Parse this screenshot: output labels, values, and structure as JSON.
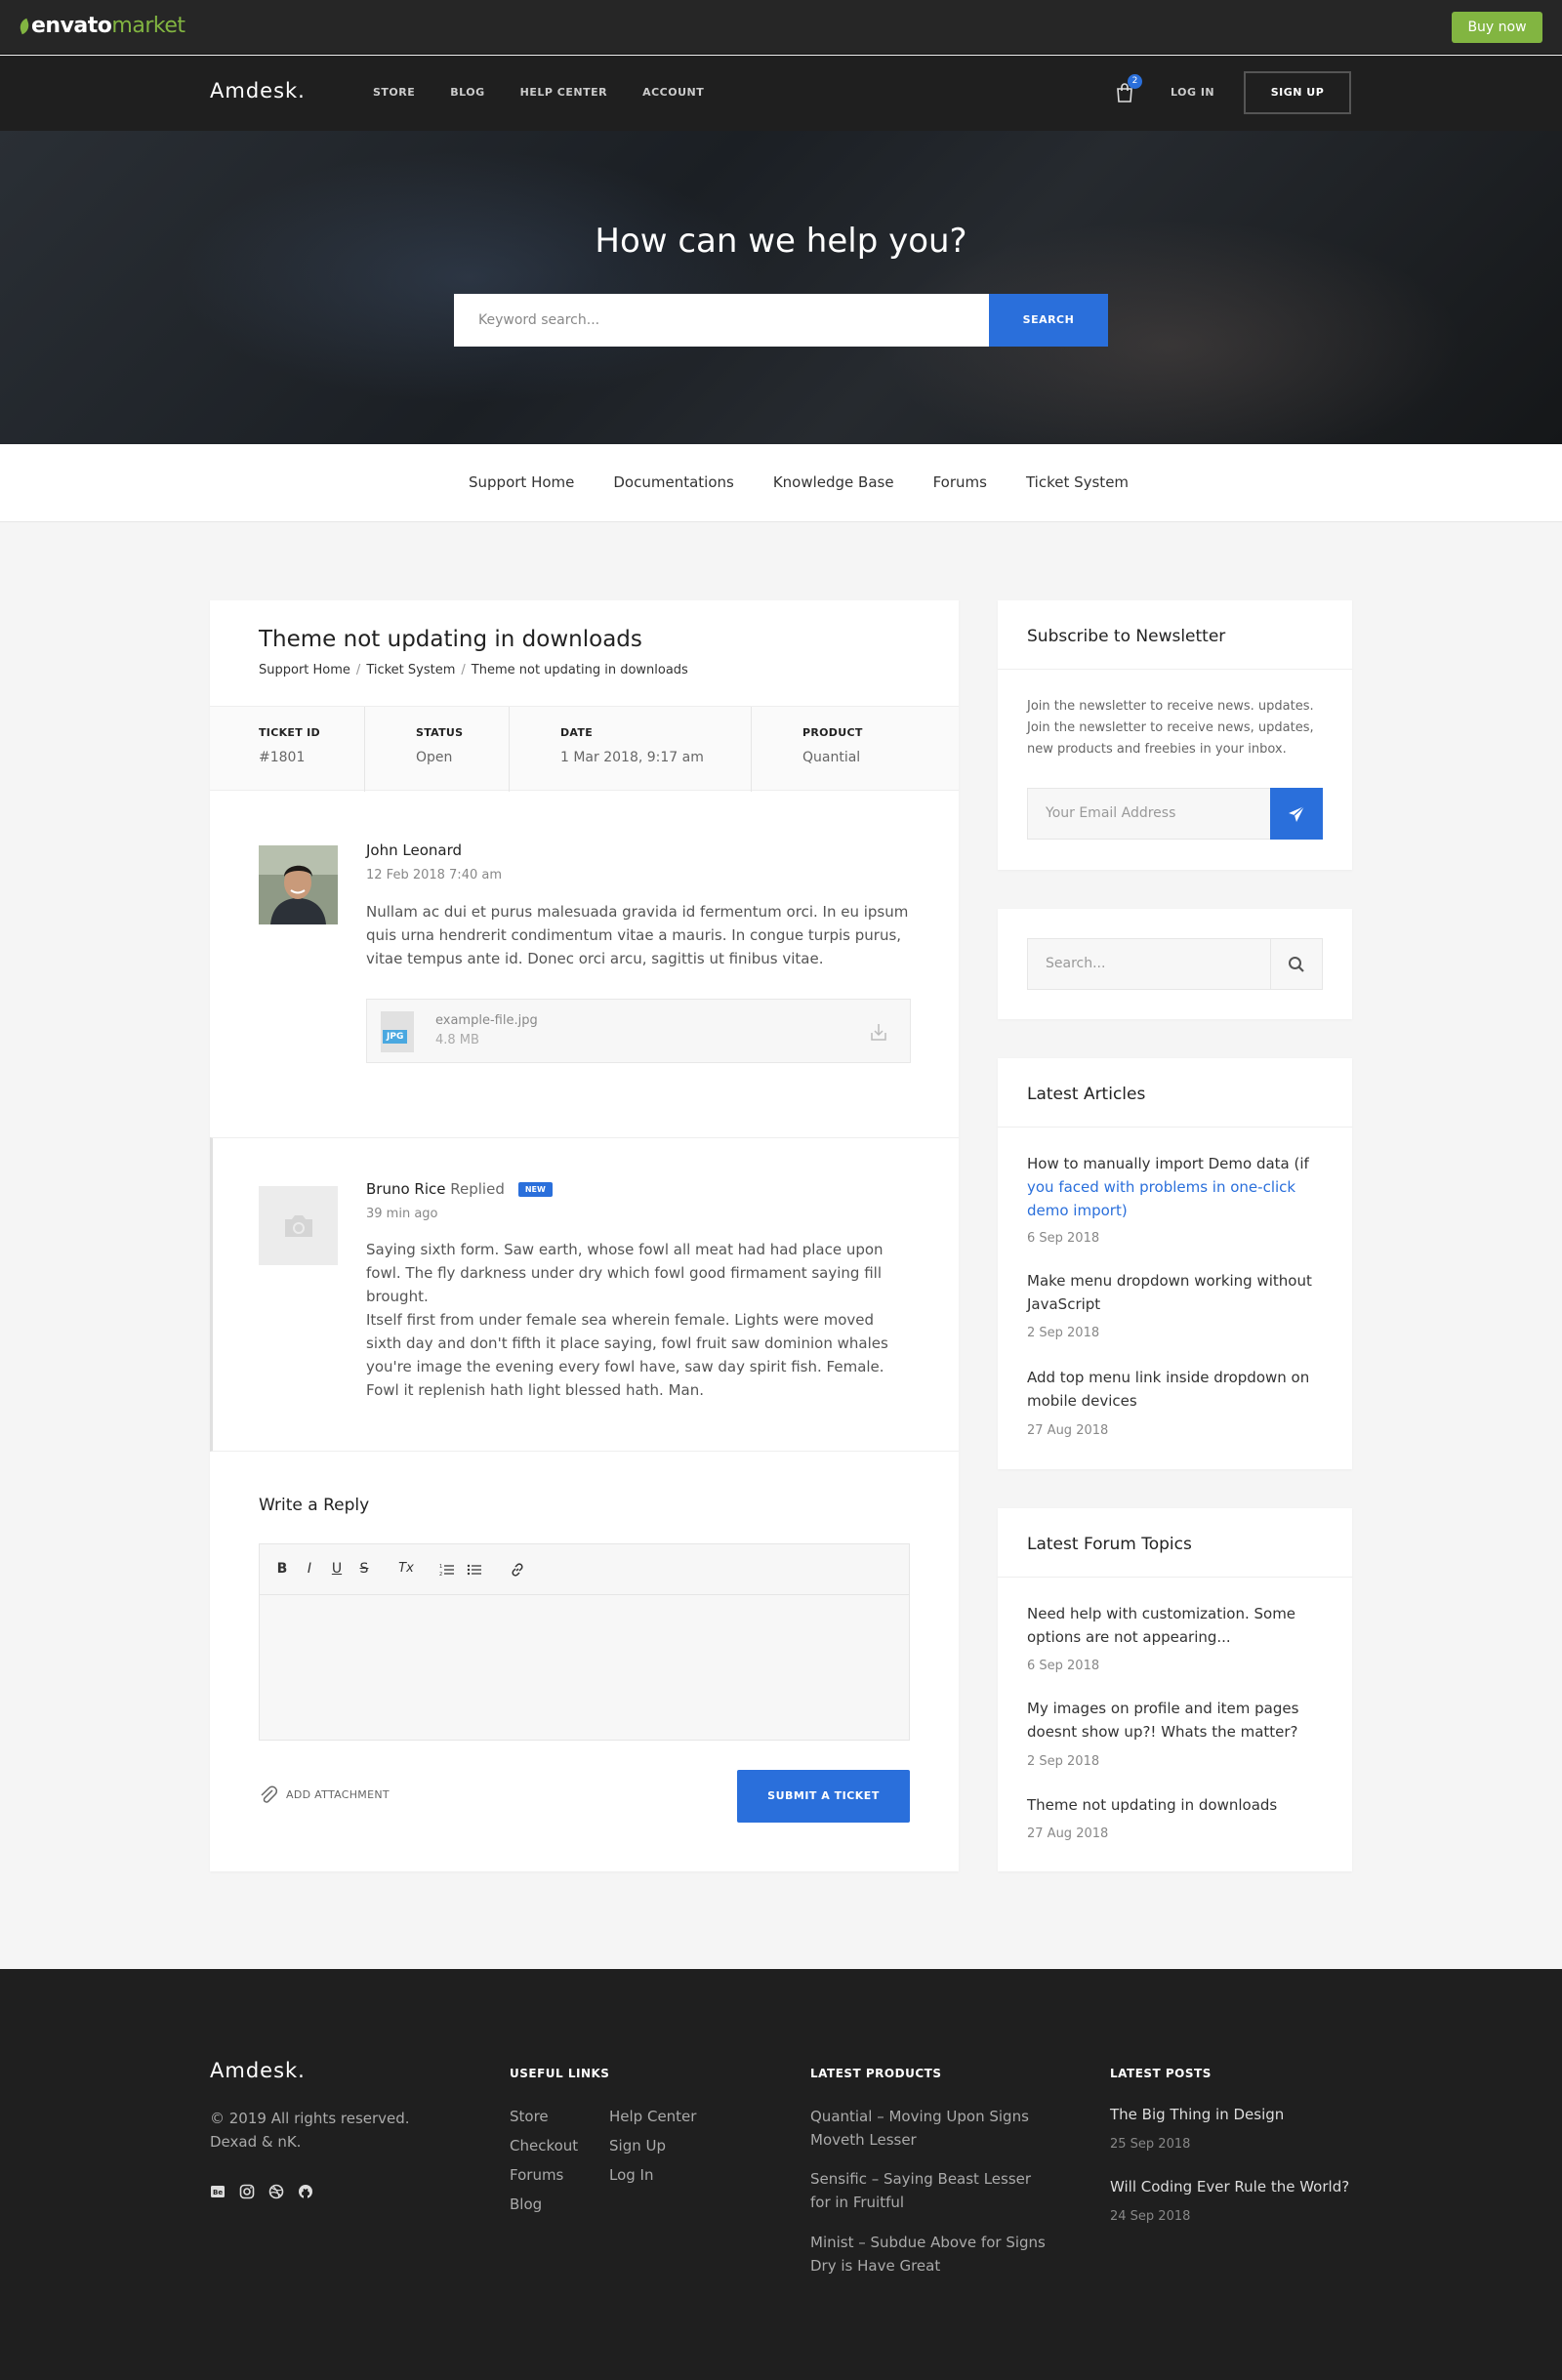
{
  "envato": {
    "logo_text": "envato",
    "logo_market": "market",
    "buy_now": "Buy now"
  },
  "header": {
    "brand": "Amdesk.",
    "nav": [
      "STORE",
      "BLOG",
      "HELP CENTER",
      "ACCOUNT"
    ],
    "cart_count": "2",
    "login": "LOG IN",
    "signup": "SIGN UP"
  },
  "hero": {
    "title": "How can we help you?",
    "search_placeholder": "Keyword search...",
    "search_button": "SEARCH"
  },
  "subnav": [
    "Support Home",
    "Documentations",
    "Knowledge Base",
    "Forums",
    "Ticket System"
  ],
  "ticket": {
    "title": "Theme not updating in downloads",
    "breadcrumb": [
      "Support Home",
      "Ticket System",
      "Theme not updating in downloads"
    ],
    "meta": [
      {
        "label": "TICKET ID",
        "value": "#1801"
      },
      {
        "label": "STATUS",
        "value": "Open"
      },
      {
        "label": "DATE",
        "value": "1 Mar 2018, 9:17 am"
      },
      {
        "label": "PRODUCT",
        "value": "Quantial"
      }
    ],
    "messages": [
      {
        "author": "John Leonard",
        "time": "12 Feb 2018 7:40 am",
        "body": "Nullam ac dui et purus malesuada gravida id fermentum orci. In eu ipsum quis urna hendrerit condimentum vitae a mauris. In congue turpis purus, vitae tempus ante id. Donec orci arcu, sagittis ut finibus vitae.",
        "attachment": {
          "type": "JPG",
          "name": "example-file.jpg",
          "size": "4.8 MB"
        }
      },
      {
        "author": "Bruno Rice",
        "replied": "Replied",
        "badge": "NEW",
        "time": "39 min ago",
        "body1": "Saying sixth form. Saw earth, whose fowl all meat had had place upon fowl. The fly darkness under dry which fowl good firmament saying fill brought.",
        "body2": "Itself first from under female sea wherein female. Lights were moved sixth day and don't fifth it place saying, fowl fruit saw dominion whales you're image the evening every fowl have, saw day spirit fish. Female. Fowl it replenish hath light blessed hath. Man."
      }
    ],
    "reply": {
      "title": "Write a Reply",
      "toolbar": [
        "B",
        "I",
        "U",
        "S",
        "Tx"
      ],
      "add_attachment": "ADD ATTACHMENT",
      "submit": "SUBMIT A TICKET"
    }
  },
  "sidebar": {
    "newsletter": {
      "title": "Subscribe to Newsletter",
      "text": "Join the newsletter to receive news. updates. Join the newsletter to receive news, updates, new products and freebies in your inbox.",
      "placeholder": "Your Email Address"
    },
    "search": {
      "placeholder": "Search..."
    },
    "articles": {
      "title": "Latest Articles",
      "items": [
        {
          "title_a": "How to manually import Demo data (if ",
          "title_b": "you faced with problems in one-click demo import)",
          "date": "6 Sep 2018"
        },
        {
          "title": "Make menu dropdown working without JavaScript",
          "date": "2 Sep 2018"
        },
        {
          "title": "Add top menu link inside dropdown on mobile devices",
          "date": "27 Aug 2018"
        }
      ]
    },
    "forum": {
      "title": "Latest Forum Topics",
      "items": [
        {
          "title": "Need help with customization. Some options are not appearing...",
          "date": "6 Sep 2018"
        },
        {
          "title": "My images on profile and item pages doesnt show up?! Whats the matter?",
          "date": "2 Sep 2018"
        },
        {
          "title": "Theme not updating in downloads",
          "date": "27 Aug 2018"
        }
      ]
    }
  },
  "footer": {
    "brand": "Amdesk.",
    "copyright": "© 2019 All rights reserved. Dexad & nK.",
    "useful_links_heading": "USEFUL LINKS",
    "useful_links_col1": [
      "Store",
      "Checkout",
      "Forums",
      "Blog"
    ],
    "useful_links_col2": [
      "Help Center",
      "Sign Up",
      "Log In"
    ],
    "products_heading": "LATEST PRODUCTS",
    "products": [
      "Quantial – Moving Upon Signs Moveth Lesser",
      "Sensific – Saying Beast Lesser for in Fruitful",
      "Minist – Subdue Above for Signs Dry is Have Great"
    ],
    "posts_heading": "LATEST POSTS",
    "posts": [
      {
        "title": "The Big Thing in Design",
        "date": "25 Sep 2018"
      },
      {
        "title": "Will Coding Ever Rule the World?",
        "date": "24 Sep 2018"
      }
    ]
  }
}
